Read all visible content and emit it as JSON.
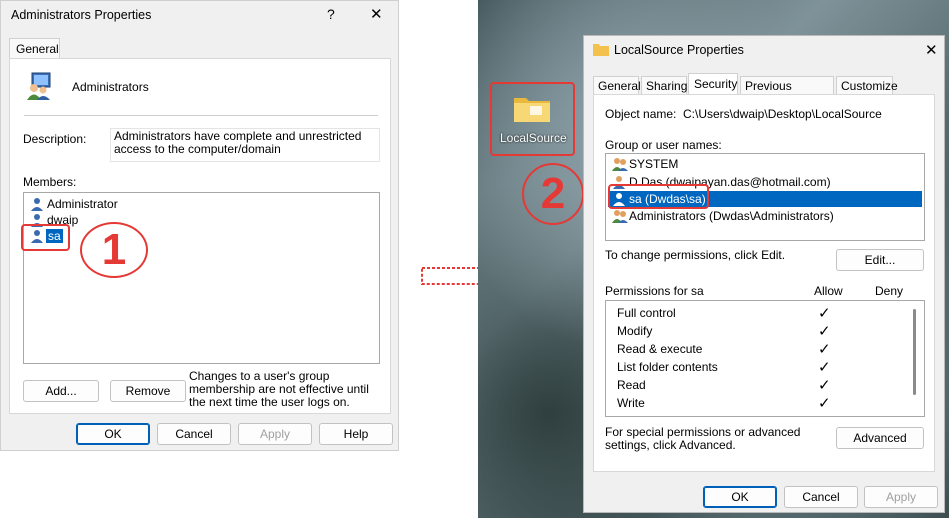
{
  "left_dialog": {
    "title": "Administrators Properties",
    "help_glyph": "?",
    "close_glyph": "✕",
    "tab": "General",
    "group_name": "Administrators",
    "description_label": "Description:",
    "description_value": "Administrators have complete and unrestricted access to the computer/domain",
    "members_label": "Members:",
    "members": [
      "Administrator",
      "dwaip",
      "sa"
    ],
    "add_label": "Add...",
    "remove_label": "Remove",
    "note": "Changes to a user's group membership are not effective until the next time the user logs on.",
    "ok_label": "OK",
    "cancel_label": "Cancel",
    "apply_label": "Apply",
    "help_label": "Help"
  },
  "annotations": {
    "step1": "1",
    "step2": "2"
  },
  "desktop": {
    "folder_label": "LocalSource"
  },
  "right_dialog": {
    "title": "LocalSource Properties",
    "close_glyph": "✕",
    "tabs": [
      "General",
      "Sharing",
      "Security",
      "Previous Versions",
      "Customize"
    ],
    "object_name_label": "Object name:",
    "object_name_value": "C:\\Users\\dwaip\\Desktop\\LocalSource",
    "group_label": "Group or user names:",
    "users": [
      "SYSTEM",
      "D Das (dwaipayan.das@hotmail.com)",
      "sa (Dwdas\\sa)",
      "Administrators (Dwdas\\Administrators)"
    ],
    "change_text": "To change permissions, click Edit.",
    "edit_label": "Edit...",
    "permissions_label": "Permissions for sa",
    "allow_header": "Allow",
    "deny_header": "Deny",
    "permissions": [
      {
        "name": "Full control",
        "allow": "✓"
      },
      {
        "name": "Modify",
        "allow": "✓"
      },
      {
        "name": "Read & execute",
        "allow": "✓"
      },
      {
        "name": "List folder contents",
        "allow": "✓"
      },
      {
        "name": "Read",
        "allow": "✓"
      },
      {
        "name": "Write",
        "allow": "✓"
      }
    ],
    "special_text": "For special permissions or advanced settings, click Advanced.",
    "advanced_label": "Advanced",
    "ok_label": "OK",
    "cancel_label": "Cancel",
    "apply_label": "Apply"
  },
  "colors": {
    "accent": "#0067c0",
    "annotation_red": "#e53935"
  }
}
